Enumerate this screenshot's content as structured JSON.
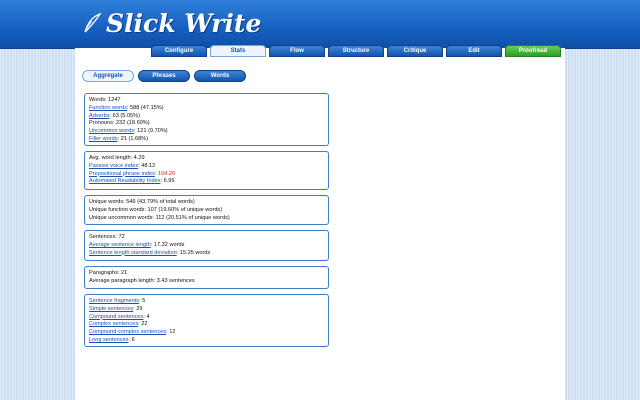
{
  "app": {
    "title": "Slick Write"
  },
  "main_tabs": [
    {
      "label": "Configure",
      "active": false
    },
    {
      "label": "Stats",
      "active": true
    },
    {
      "label": "Flow",
      "active": false
    },
    {
      "label": "Structure",
      "active": false
    },
    {
      "label": "Critique",
      "active": false
    },
    {
      "label": "Edit",
      "active": false
    },
    {
      "label": "Proofread",
      "active": false,
      "color": "#3aa531"
    }
  ],
  "sub_tabs": [
    {
      "label": "Aggregate",
      "active": true
    },
    {
      "label": "Phrases",
      "active": false
    },
    {
      "label": "Words",
      "active": false
    }
  ],
  "stats": {
    "words": "Words: 1247",
    "function_words_label": "Function words",
    "function_words_value": ": 588 (47.15%)",
    "adverbs_label": "Adverbs",
    "adverbs_value": ": 63 (5.05%)",
    "pronouns": "Pronouns: 232 (18.60%)",
    "uncommon_words_label": "Uncommon words",
    "uncommon_words_value": ": 121 (9.70%)",
    "filler_words_label": "Filler words",
    "filler_words_value": ": 21 (1.68%)",
    "avg_word_length": "Avg. word length: 4.29",
    "passive_voice_label": "Passive voice index",
    "passive_voice_value": ": 48.12",
    "prepositional_label": "Prepositional phrase index",
    "prepositional_value": ": 104.20",
    "ari_label": "Automated Readability Index",
    "ari_value": ": 6.99",
    "unique_words": "Unique words: 546 (43.79% of total words)",
    "unique_function_words": "Unique function words: 107 (19.60% of unique words)",
    "unique_uncommon_words": "Unique uncommon words: 112 (20.51% of unique words)",
    "sentences": "Sentences: 72",
    "avg_sentence_label": "Average sentence length",
    "avg_sentence_value": ": 17.32 words",
    "sentence_sd_label": "Sentence length standard deviation",
    "sentence_sd_value": ": 15.25 words",
    "paragraphs": "Paragraphs: 21",
    "avg_paragraph": "Average paragraph length: 3.43 sentences",
    "fragments_label": "Sentence fragments",
    "fragments_value": ": 5",
    "simple_label": "Simple sentences",
    "simple_value": ": 29",
    "compound_label": "Compound sentences",
    "compound_value": ": 4",
    "complex_label": "Complex sentences",
    "complex_value": ": 22",
    "compound_complex_label": "Compound-complex sentences",
    "compound_complex_value": ": 12",
    "long_label": "Long sentences",
    "long_value": ": 6"
  },
  "colors": {
    "accent": "#1654ad",
    "warning": "#d01919"
  }
}
